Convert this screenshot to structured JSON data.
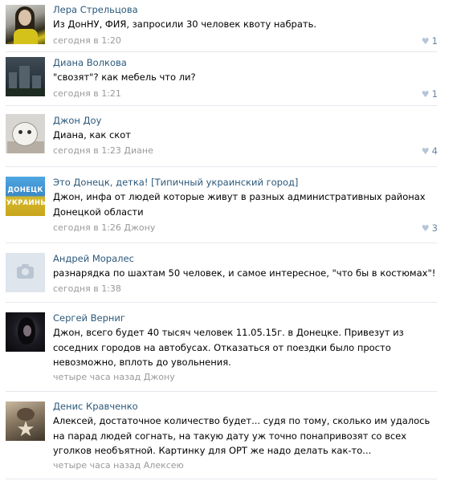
{
  "comments": [
    {
      "author": "Лера Стрельцова",
      "text": "Из ДонНУ, ФИЯ, запросили 30 человек квоту набрать.",
      "time": "сегодня в 1:20",
      "reply_to": "",
      "likes": "1",
      "avatar_icon": "user-photo-woman-yellow-top"
    },
    {
      "author": "Диана Волкова",
      "text": "\"свозят\"? как мебель что ли?",
      "time": "сегодня в 1:21",
      "reply_to": "",
      "likes": "1",
      "avatar_icon": "user-photo-city-night"
    },
    {
      "author": "Джон Доу",
      "text": "Диана, как скот",
      "time": "сегодня в 1:23",
      "reply_to": "Диане",
      "likes": "4",
      "avatar_icon": "user-photo-mask"
    },
    {
      "author": "Это Донецк, детка! [Типичный украинский город]",
      "text": "Джон, инфа от людей которые живут в разных административных районах Донецкой области",
      "time": "сегодня в 1:26",
      "reply_to": "Джону",
      "likes": "3",
      "avatar_icon": "group-logo-donetsk-ukraine",
      "avatar_text_top": "ДОНЕЦК",
      "avatar_text_bottom": "УКРАИНЫ"
    },
    {
      "author": "Андрей Моралес",
      "text": "разнарядка по шахтам 50 человек, и самое интересное, \"что бы в костюмах\"!",
      "time": "сегодня в 1:38",
      "reply_to": "",
      "likes": "",
      "avatar_icon": "camera-placeholder-icon"
    },
    {
      "author": "Сергей Верниг",
      "text": "Джон, всего будет 40 тысяч человек 11.05.15г. в Донецке. Привезут из соседних городов на автобусах. Отказаться от поездки было просто невозможно, вплоть до увольнения.",
      "time": "четыре часа назад",
      "reply_to": "Джону",
      "likes": "",
      "avatar_icon": "user-photo-dark-portrait"
    },
    {
      "author": "Денис Кравченко",
      "text": "Алексей, достаточное количество будет... судя по тому, сколько им удалось на парад людей согнать, на такую дату уж точно понапривозят со всех уголков необъятной. Картинку для ОРТ же надо делать как-то...",
      "time": "четыре часа назад",
      "reply_to": "Алексею",
      "likes": "",
      "avatar_icon": "user-photo-star-walk"
    }
  ],
  "colors": {
    "author_link": "#2b587a",
    "meta_text": "#999999",
    "like_count": "#6e84a0",
    "divider": "#e4e8ed"
  }
}
